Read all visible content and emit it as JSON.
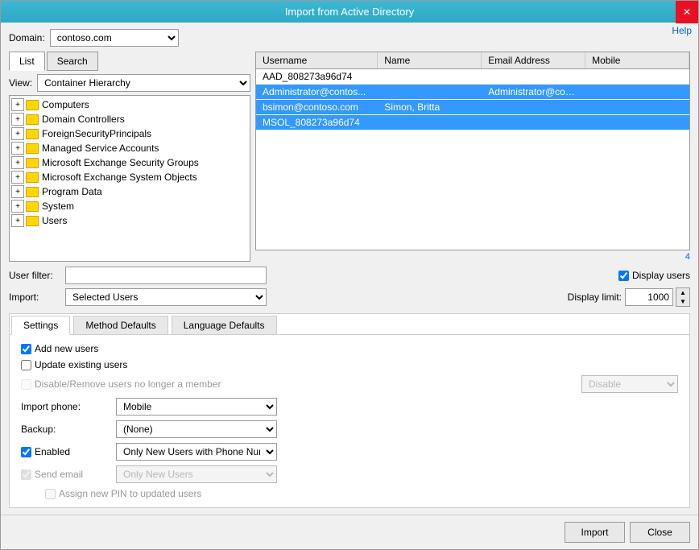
{
  "window": {
    "title": "Import from Active Directory",
    "help_link": "Help",
    "close_btn": "✕"
  },
  "domain": {
    "label": "Domain:",
    "value": "contoso.com"
  },
  "tabs": {
    "list_label": "List",
    "search_label": "Search"
  },
  "view": {
    "label": "View:",
    "value": "Container Hierarchy"
  },
  "tree": {
    "items": [
      {
        "label": "Computers",
        "expander": "+"
      },
      {
        "label": "Domain Controllers",
        "expander": "+"
      },
      {
        "label": "ForeignSecurityPrincipals",
        "expander": "+"
      },
      {
        "label": "Managed Service Accounts",
        "expander": "+"
      },
      {
        "label": "Microsoft Exchange Security Groups",
        "expander": "+"
      },
      {
        "label": "Microsoft Exchange System Objects",
        "expander": "+"
      },
      {
        "label": "Program Data",
        "expander": "+"
      },
      {
        "label": "System",
        "expander": "+"
      },
      {
        "label": "Users",
        "expander": "+"
      }
    ]
  },
  "table": {
    "headers": [
      "Username",
      "Name",
      "Email Address",
      "Mobile"
    ],
    "rows": [
      {
        "username": "AAD_808273a96d74",
        "name": "",
        "email": "",
        "mobile": "",
        "selected": false
      },
      {
        "username": "Administrator@contos...",
        "name": "",
        "email": "Administrator@contos...",
        "mobile": "",
        "selected": true
      },
      {
        "username": "bsimon@contoso.com",
        "name": "Simon, Britta",
        "email": "",
        "mobile": "",
        "selected": true
      },
      {
        "username": "MSOL_808273a96d74",
        "name": "",
        "email": "",
        "mobile": "",
        "selected": true
      }
    ],
    "page_number": "4"
  },
  "filter": {
    "label": "User filter:",
    "placeholder": "",
    "display_users_label": "Display users",
    "display_users_checked": true
  },
  "import": {
    "label": "Import:",
    "value": "Selected Users",
    "display_limit_label": "Display limit:",
    "display_limit_value": "1000"
  },
  "settings_tabs": [
    {
      "label": "Settings",
      "active": true
    },
    {
      "label": "Method Defaults",
      "active": false
    },
    {
      "label": "Language Defaults",
      "active": false
    }
  ],
  "settings": {
    "add_new_users": {
      "label": "Add new users",
      "checked": true
    },
    "update_existing": {
      "label": "Update existing users",
      "checked": false
    },
    "disable_remove": {
      "label": "Disable/Remove users no longer a member",
      "checked": false,
      "disabled": true
    },
    "disable_option": "Disable",
    "import_phone": {
      "label": "Import phone:",
      "value": "Mobile"
    },
    "backup": {
      "label": "Backup:",
      "value": "(None)"
    },
    "enabled": {
      "label": "Enabled",
      "checked": true,
      "value": "Only New Users with Phone Number"
    },
    "send_email": {
      "label": "Send email",
      "checked": false,
      "disabled": true,
      "value": "Only New Users"
    },
    "assign_pin": {
      "label": "Assign new PIN to updated users",
      "checked": false,
      "disabled": true
    }
  },
  "footer": {
    "import_btn": "Import",
    "close_btn": "Close"
  }
}
